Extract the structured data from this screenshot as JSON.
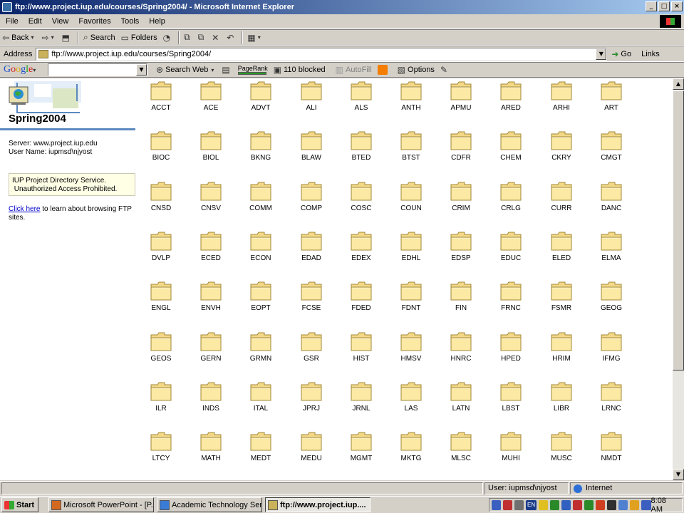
{
  "window": {
    "title": "ftp://www.project.iup.edu/courses/Spring2004/ - Microsoft Internet Explorer",
    "controls": [
      "_",
      "□",
      "×"
    ]
  },
  "menu": [
    "File",
    "Edit",
    "View",
    "Favorites",
    "Tools",
    "Help"
  ],
  "toolbar": {
    "back": "Back",
    "search": "Search",
    "folders": "Folders"
  },
  "address": {
    "label": "Address",
    "value": "ftp://www.project.iup.edu/courses/Spring2004/",
    "go": "Go",
    "links": "Links"
  },
  "google": {
    "logo": [
      "G",
      "o",
      "o",
      "g",
      "l",
      "e"
    ],
    "search_web": "Search Web",
    "pagerank": "PageRank",
    "blocked": "110 blocked",
    "autofill": "AutoFill",
    "options": "Options"
  },
  "left_panel": {
    "title": "Spring2004",
    "server_line": "Server: www.project.iup.edu",
    "user_line": "User Name: iupmsd\\njyost",
    "notice_line1": "IUP Project Directory Service.",
    "notice_line2": " Unauthorized Access Prohibited.",
    "help_link": "Click here",
    "help_text": " to learn about browsing FTP sites."
  },
  "folders": [
    [
      "ACCT",
      "ACE",
      "ADVT",
      "ALI",
      "ALS",
      "ANTH",
      "APMU",
      "ARED",
      "ARHI",
      "ART"
    ],
    [
      "BIOC",
      "BIOL",
      "BKNG",
      "BLAW",
      "BTED",
      "BTST",
      "CDFR",
      "CHEM",
      "CKRY",
      "CMGT"
    ],
    [
      "CNSD",
      "CNSV",
      "COMM",
      "COMP",
      "COSC",
      "COUN",
      "CRIM",
      "CRLG",
      "CURR",
      "DANC"
    ],
    [
      "DVLP",
      "ECED",
      "ECON",
      "EDAD",
      "EDEX",
      "EDHL",
      "EDSP",
      "EDUC",
      "ELED",
      "ELMA"
    ],
    [
      "ENGL",
      "ENVH",
      "EOPT",
      "FCSE",
      "FDED",
      "FDNT",
      "FIN",
      "FRNC",
      "FSMR",
      "GEOG"
    ],
    [
      "GEOS",
      "GERN",
      "GRMN",
      "GSR",
      "HIST",
      "HMSV",
      "HNRC",
      "HPED",
      "HRIM",
      "IFMG"
    ],
    [
      "ILR",
      "INDS",
      "ITAL",
      "JPRJ",
      "JRNL",
      "LAS",
      "LATN",
      "LBST",
      "LIBR",
      "LRNC"
    ],
    [
      "LTCY",
      "MATH",
      "MEDT",
      "MEDU",
      "MGMT",
      "MKTG",
      "MLSC",
      "MUHI",
      "MUSC",
      "NMDT"
    ]
  ],
  "status": {
    "user": "User: iupmsd\\njyost",
    "zone": "Internet"
  },
  "taskbar": {
    "start": "Start",
    "tasks": [
      "Microsoft PowerPoint - [P...",
      "Academic Technology Ser...",
      "ftp://www.project.iup...."
    ],
    "lang": "EN",
    "clock": "8:08 AM"
  }
}
